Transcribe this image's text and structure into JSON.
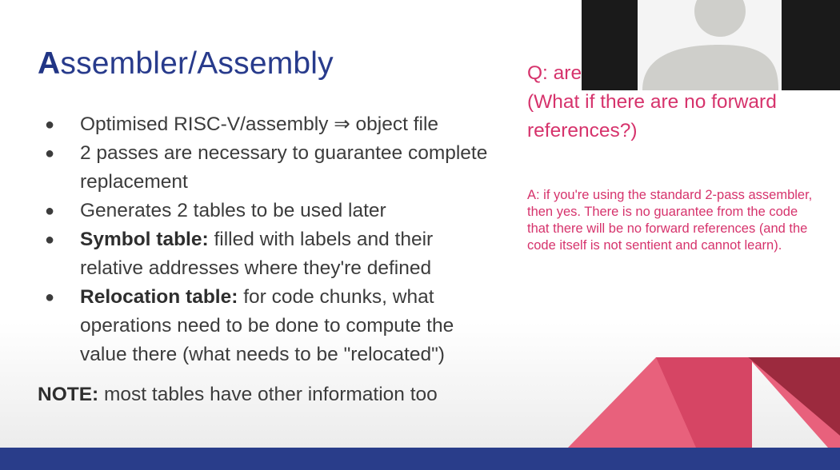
{
  "slide": {
    "title_first_letter": "A",
    "title_rest": "ssembler/Assembly",
    "bullets": [
      {
        "bold": "",
        "text": "Optimised RISC-V/assembly ⇒ object file"
      },
      {
        "bold": "",
        "text": "2 passes are necessary to guarantee complete replacement"
      },
      {
        "bold": "",
        "text": "Generates 2 tables to be used later"
      },
      {
        "bold": "Symbol table:",
        "text": " filled with labels and their relative addresses where they're defined"
      },
      {
        "bold": "Relocation table:",
        "text": " for code chunks, what operations need to be done to compute the value there (what needs to be \"relocated\")"
      }
    ],
    "note_bold": "NOTE:",
    "note_text": " most tables have other information too",
    "question": "Q: are                       necessary? (What if there are no forward references?)",
    "answer": "A: if you're using the standard 2-pass assembler, then yes. There is no guarantee from the code that there will be no forward references (and the code itself is not sentient and cannot learn).",
    "bullet_glyph": "●"
  },
  "colors": {
    "title": "#283b8c",
    "accent_pink": "#d6336c",
    "footer": "#293d8a"
  },
  "webcam": {
    "icon": "person-avatar-icon"
  }
}
